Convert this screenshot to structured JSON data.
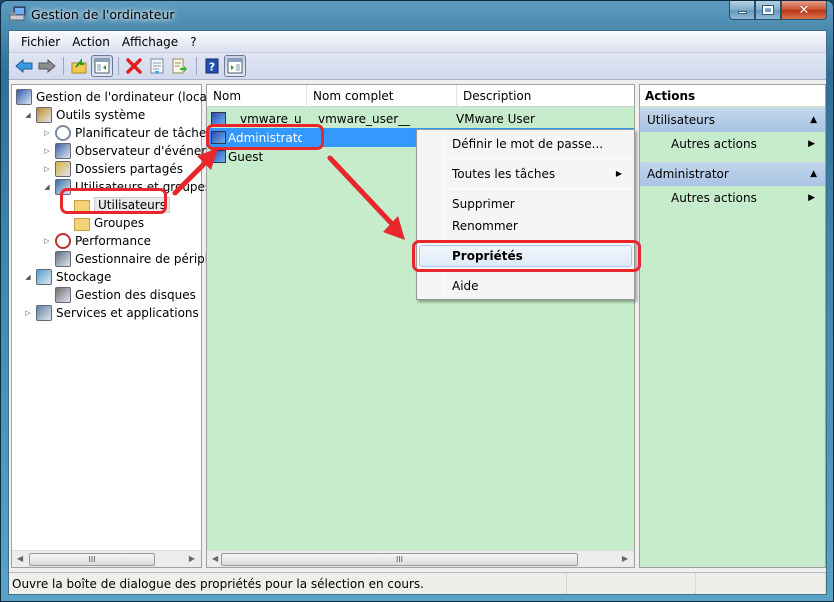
{
  "window": {
    "title": "Gestion de l'ordinateur",
    "caption_buttons": [
      "minimize",
      "maximize",
      "close"
    ]
  },
  "menubar": {
    "items": [
      "Fichier",
      "Action",
      "Affichage",
      "?"
    ]
  },
  "toolbar": {
    "buttons": [
      {
        "name": "back-icon"
      },
      {
        "name": "forward-icon"
      },
      {
        "name": "up-folder-icon"
      },
      {
        "name": "show-hide-console-tree-icon",
        "pressed": true
      },
      {
        "name": "delete-icon"
      },
      {
        "name": "properties-icon"
      },
      {
        "name": "export-list-icon"
      },
      {
        "name": "help-icon"
      },
      {
        "name": "show-hide-action-pane-icon",
        "pressed": true
      }
    ]
  },
  "tree": {
    "items": [
      {
        "label": "Gestion de l'ordinateur (local)",
        "level": 0,
        "expander": "",
        "icon": "computer-management-icon"
      },
      {
        "label": "Outils système",
        "level": 1,
        "expander": "expanded",
        "icon": "system-tools-icon"
      },
      {
        "label": "Planificateur de tâches",
        "level": 2,
        "expander": "collapsed",
        "icon": "clock-icon"
      },
      {
        "label": "Observateur d'événeme",
        "level": 2,
        "expander": "collapsed",
        "icon": "event-viewer-icon"
      },
      {
        "label": "Dossiers partagés",
        "level": 2,
        "expander": "collapsed",
        "icon": "shared-folders-icon"
      },
      {
        "label": "Utilisateurs et groupes l",
        "level": 2,
        "expander": "expanded",
        "icon": "users-groups-icon"
      },
      {
        "label": "Utilisateurs",
        "level": 3,
        "expander": "",
        "icon": "folder-icon",
        "selected": true
      },
      {
        "label": "Groupes",
        "level": 3,
        "expander": "",
        "icon": "folder-icon"
      },
      {
        "label": "Performance",
        "level": 2,
        "expander": "collapsed",
        "icon": "performance-icon"
      },
      {
        "label": "Gestionnaire de périphé",
        "level": 2,
        "expander": "",
        "icon": "device-manager-icon"
      },
      {
        "label": "Stockage",
        "level": 1,
        "expander": "expanded",
        "icon": "storage-icon"
      },
      {
        "label": "Gestion des disques",
        "level": 2,
        "expander": "",
        "icon": "disk-management-icon"
      },
      {
        "label": "Services et applications",
        "level": 1,
        "expander": "collapsed",
        "icon": "services-icon"
      }
    ]
  },
  "list": {
    "columns": [
      "Nom",
      "Nom complet",
      "Description"
    ],
    "rows": [
      {
        "name": "__vmware_u...",
        "full_name": "__vmware_user__",
        "description": "VMware User"
      },
      {
        "name": "Administrator",
        "full_name": "",
        "description": "",
        "selected": true
      },
      {
        "name": "Guest",
        "full_name": "",
        "description": ""
      }
    ]
  },
  "context_menu": {
    "items": [
      {
        "label": "Définir le mot de passe..."
      },
      {
        "label": "Toutes les tâches",
        "submenu": true
      },
      {
        "label": "Supprimer"
      },
      {
        "label": "Renommer"
      },
      {
        "label": "Propriétés",
        "highlighted": true
      },
      {
        "label": "Aide"
      }
    ]
  },
  "actions": {
    "title": "Actions",
    "sections": [
      {
        "label": "Utilisateurs",
        "items": [
          "Autres actions"
        ]
      },
      {
        "label": "Administrator",
        "items": [
          "Autres actions"
        ]
      }
    ]
  },
  "statusbar": {
    "text": "Ouvre la boîte de dialogue des propriétés pour la sélection en cours."
  },
  "colors": {
    "selection": "#3399ff",
    "list_background": "#c6eccb",
    "annotation": "#e8262c"
  }
}
